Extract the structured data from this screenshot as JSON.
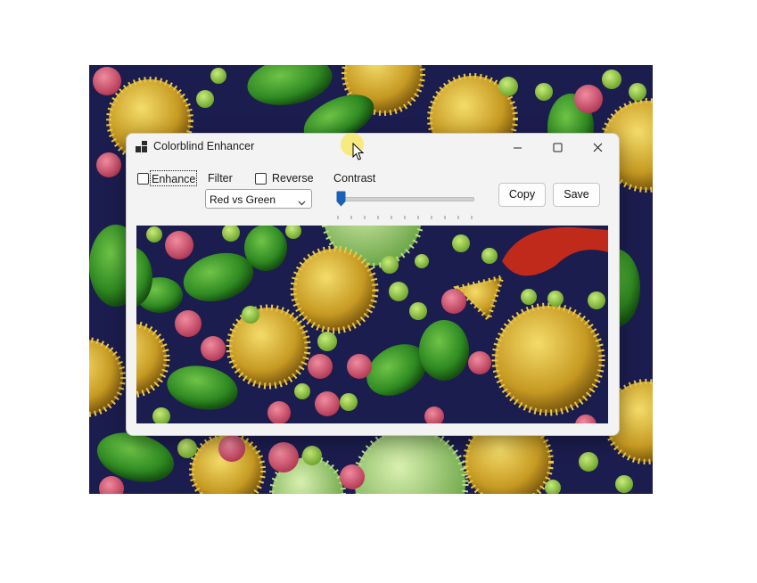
{
  "window": {
    "title": "Colorblind Enhancer",
    "app_icon": "app-tiles-icon",
    "controls": {
      "minimize_icon": "minimize-icon",
      "maximize_icon": "maximize-icon",
      "close_icon": "close-icon"
    }
  },
  "toolbar": {
    "enhance": {
      "label": "Enhance",
      "checked": false
    },
    "filter": {
      "label": "Filter",
      "selected": "Red vs Green"
    },
    "reverse": {
      "label": "Reverse",
      "checked": false
    },
    "contrast": {
      "label": "Contrast",
      "level": 0.0
    },
    "copy_label": "Copy",
    "save_label": "Save"
  },
  "colors": {
    "pollen_yellow": "#d8b332",
    "pollen_green": "#3f9a2c",
    "pollen_pink": "#d0506a",
    "pollen_light_green": "#9ccc4a",
    "background_navy": "#1c1d4f",
    "accent_blue": "#1a62b5",
    "highlight_red": "#c02a1a"
  }
}
